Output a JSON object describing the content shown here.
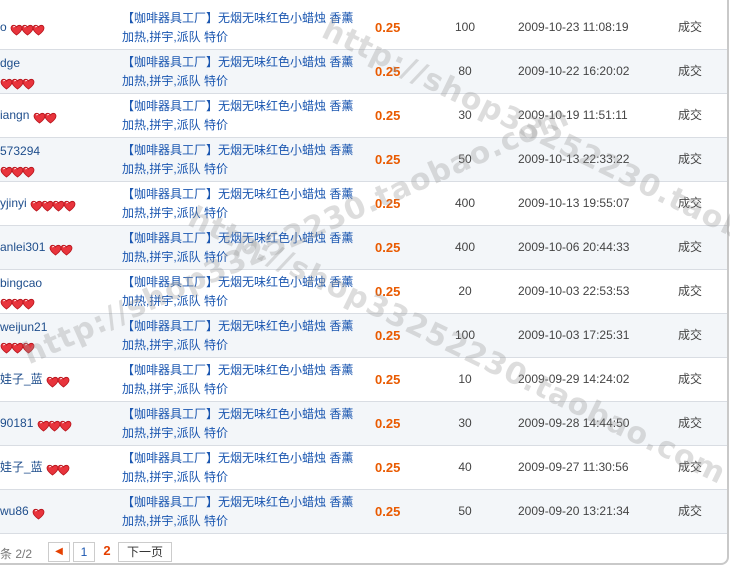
{
  "colors": {
    "price": "#e95a00",
    "link": "#1a56b0",
    "buyer": "#1f4e8c",
    "heart": "#e8343c",
    "row_alt": "#f3f6f9"
  },
  "rows": [
    {
      "buyer": "o",
      "hearts": 3,
      "wrap": false,
      "title": "【咖啡器具工厂】无烟无味红色小蜡烛 香薰加热,拼宇,派队 特价",
      "price": "0.25",
      "qty": "100",
      "date": "2009-10-23 11:08:19",
      "status": "成交"
    },
    {
      "buyer": "dge",
      "hearts": 3,
      "wrap": true,
      "title": "【咖啡器具工厂】无烟无味红色小蜡烛 香薰加热,拼宇,派队 特价",
      "price": "0.25",
      "qty": "80",
      "date": "2009-10-22 16:20:02",
      "status": "成交"
    },
    {
      "buyer": "iangn",
      "hearts": 2,
      "wrap": false,
      "title": "【咖啡器具工厂】无烟无味红色小蜡烛 香薰加热,拼宇,派队 特价",
      "price": "0.25",
      "qty": "30",
      "date": "2009-10-19 11:51:11",
      "status": "成交"
    },
    {
      "buyer": "573294",
      "hearts": 3,
      "wrap": true,
      "title": "【咖啡器具工厂】无烟无味红色小蜡烛 香薰加热,拼宇,派队 特价",
      "price": "0.25",
      "qty": "50",
      "date": "2009-10-13 22:33:22",
      "status": "成交"
    },
    {
      "buyer": "yjinyi",
      "hearts": 4,
      "wrap": false,
      "title": "【咖啡器具工厂】无烟无味红色小蜡烛 香薰加热,拼宇,派队 特价",
      "price": "0.25",
      "qty": "400",
      "date": "2009-10-13 19:55:07",
      "status": "成交"
    },
    {
      "buyer": "anlei301",
      "hearts": 2,
      "wrap": false,
      "title": "【咖啡器具工厂】无烟无味红色小蜡烛 香薰加热,拼宇,派队 特价",
      "price": "0.25",
      "qty": "400",
      "date": "2009-10-06 20:44:33",
      "status": "成交"
    },
    {
      "buyer": "bingcao",
      "hearts": 3,
      "wrap": true,
      "title": "【咖啡器具工厂】无烟无味红色小蜡烛 香薰加热,拼宇,派队 特价",
      "price": "0.25",
      "qty": "20",
      "date": "2009-10-03 22:53:53",
      "status": "成交"
    },
    {
      "buyer": "weijun21",
      "hearts": 3,
      "wrap": true,
      "title": "【咖啡器具工厂】无烟无味红色小蜡烛 香薰加热,拼宇,派队 特价",
      "price": "0.25",
      "qty": "100",
      "date": "2009-10-03 17:25:31",
      "status": "成交"
    },
    {
      "buyer": "娃子_蓝",
      "hearts": 2,
      "wrap": false,
      "title": "【咖啡器具工厂】无烟无味红色小蜡烛 香薰加热,拼宇,派队 特价",
      "price": "0.25",
      "qty": "10",
      "date": "2009-09-29 14:24:02",
      "status": "成交"
    },
    {
      "buyer": "90181",
      "hearts": 3,
      "wrap": false,
      "title": "【咖啡器具工厂】无烟无味红色小蜡烛 香薰加热,拼宇,派队 特价",
      "price": "0.25",
      "qty": "30",
      "date": "2009-09-28 14:44:50",
      "status": "成交"
    },
    {
      "buyer": "娃子_蓝",
      "hearts": 2,
      "wrap": false,
      "title": "【咖啡器具工厂】无烟无味红色小蜡烛 香薰加热,拼宇,派队 特价",
      "price": "0.25",
      "qty": "40",
      "date": "2009-09-27 11:30:56",
      "status": "成交"
    },
    {
      "buyer": "wu86",
      "hearts": 1,
      "wrap": false,
      "title": "【咖啡器具工厂】无烟无味红色小蜡烛 香薰加热,拼宇,派队 特价",
      "price": "0.25",
      "qty": "50",
      "date": "2009-09-20 13:21:34",
      "status": "成交"
    }
  ],
  "pagination": {
    "info": "条 2/2",
    "prev_icon": "arrow-left-icon",
    "page1": "1",
    "current": "2",
    "next": "下一页"
  },
  "watermark": "http://shop33252230.taobao.com"
}
